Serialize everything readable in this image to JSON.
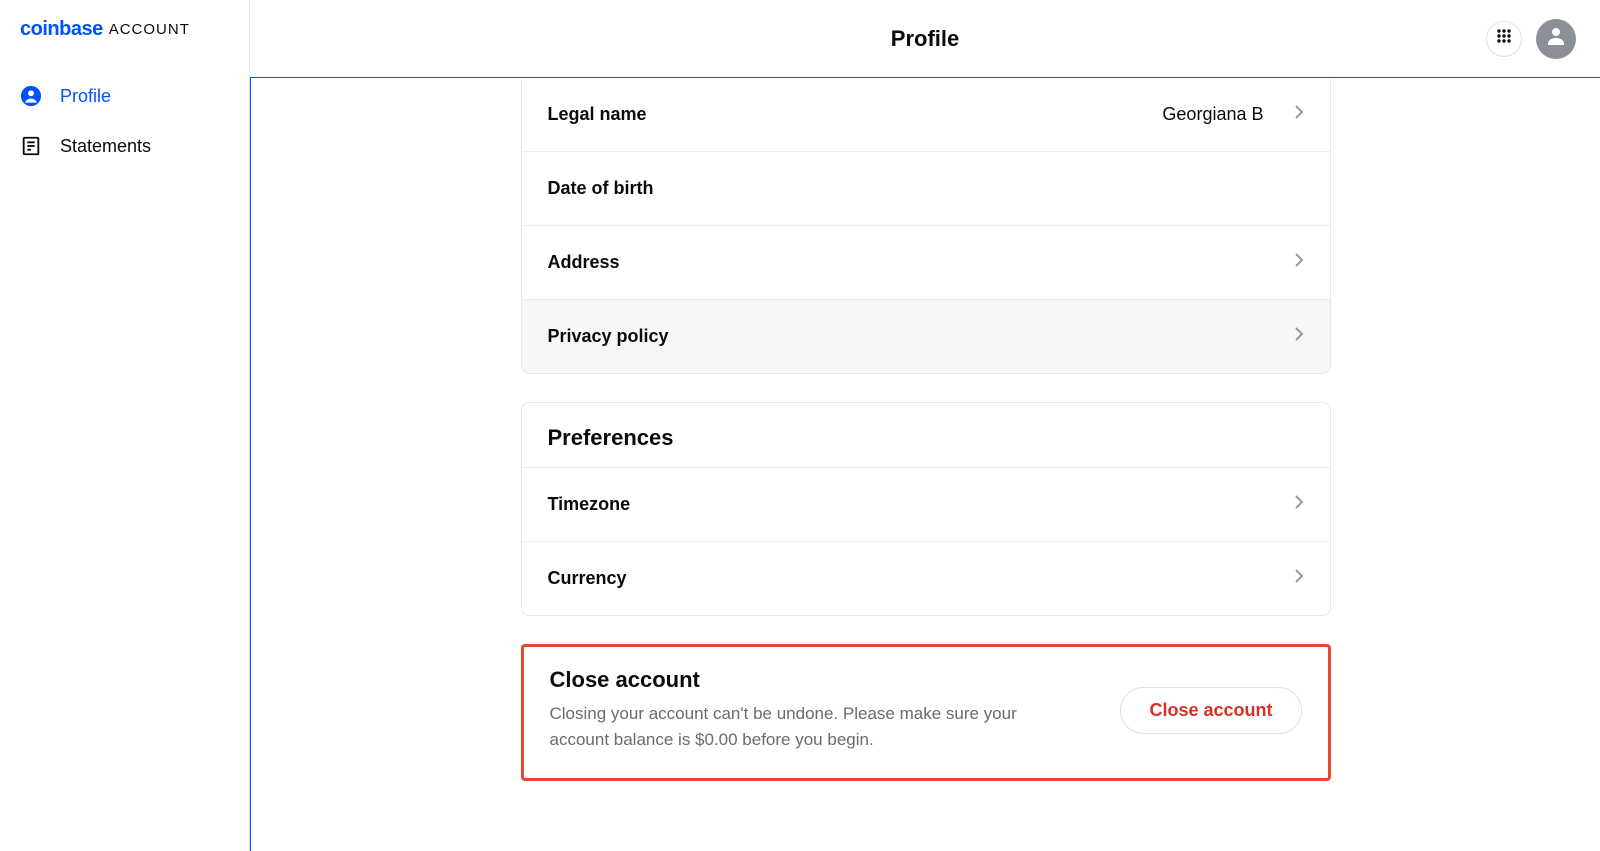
{
  "brand": {
    "logo": "coinbase",
    "sub": "ACCOUNT"
  },
  "sidebar": {
    "items": [
      {
        "label": "Profile"
      },
      {
        "label": "Statements"
      }
    ]
  },
  "header": {
    "title": "Profile"
  },
  "personal": {
    "rows": [
      {
        "label": "Legal name",
        "value": "Georgiana B",
        "arrow": true
      },
      {
        "label": "Date of birth",
        "value": "",
        "arrow": false
      },
      {
        "label": "Address",
        "value": "",
        "arrow": true
      },
      {
        "label": "Privacy policy",
        "value": "",
        "arrow": true
      }
    ]
  },
  "preferences": {
    "title": "Preferences",
    "rows": [
      {
        "label": "Timezone",
        "value": "",
        "arrow": true
      },
      {
        "label": "Currency",
        "value": "",
        "arrow": true
      }
    ]
  },
  "close": {
    "title": "Close account",
    "desc": "Closing your account can't be undone. Please make sure your account balance is $0.00 before you begin.",
    "button": "Close account"
  }
}
